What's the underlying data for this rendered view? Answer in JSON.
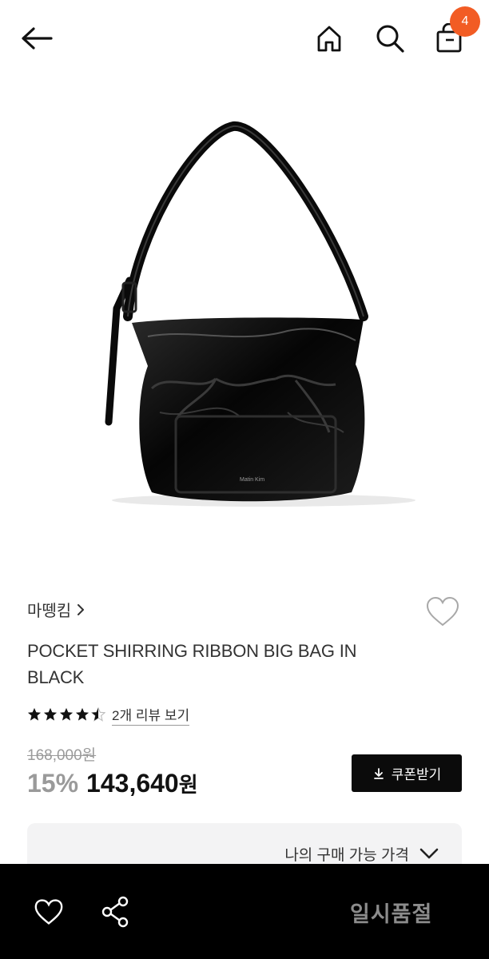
{
  "header": {
    "back_icon": "arrow-left-icon",
    "home_icon": "home-icon",
    "search_icon": "search-icon",
    "cart_icon": "shopping-bag-icon",
    "cart_count": "4",
    "badge_color": "#f25c24"
  },
  "product": {
    "image": "black-shoulder-bag-photo",
    "image_logo_text": "Matin Kim",
    "brand": "마뗑킴",
    "brand_chevron": "chevron-right-icon",
    "title": "POCKET SHIRRING RIBBON BIG BAG IN BLACK",
    "rating": 4.5,
    "rating_max": 5,
    "review_link": "2개 리뷰 보기",
    "original_price": "168,000원",
    "discount": "15%",
    "sale_price": "143,640",
    "currency_unit": "원"
  },
  "coupon_button": {
    "label": "쿠폰받기",
    "icon": "download-icon"
  },
  "price_panel": {
    "label": "나의 구매 가능 가격",
    "icon": "chevron-down-icon"
  },
  "bottom_bar": {
    "wish_icon": "heart-icon",
    "share_icon": "share-icon",
    "status": "일시품절"
  }
}
